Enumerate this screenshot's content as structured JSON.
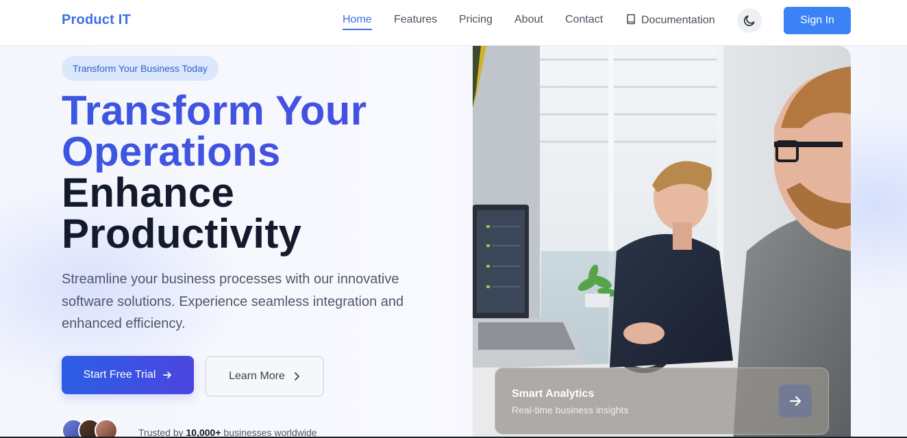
{
  "nav": {
    "brand": "Product IT",
    "links": [
      {
        "label": "Home",
        "active": true
      },
      {
        "label": "Features",
        "active": false
      },
      {
        "label": "Pricing",
        "active": false
      },
      {
        "label": "About",
        "active": false
      },
      {
        "label": "Contact",
        "active": false
      },
      {
        "label": "Documentation",
        "active": false,
        "icon": "book-icon"
      }
    ],
    "theme_toggle_icon": "moon-icon",
    "signin_label": "Sign In"
  },
  "hero": {
    "badge": "Transform Your Business Today",
    "headline_line1": "Transform Your",
    "headline_line2": "Operations",
    "headline_line3": "Enhance",
    "headline_line4": "Productivity",
    "subtitle": "Streamline your business processes with our innovative software solutions. Experience seamless integration and enhanced efficiency.",
    "primary_cta": "Start Free Trial",
    "secondary_cta": "Learn More",
    "trusted_prefix": "Trusted by",
    "trusted_count": "10,000+",
    "trusted_suffix": "businesses worldwide"
  },
  "card": {
    "title": "Smart Analytics",
    "subtitle": "Real-time business insights",
    "button_icon": "arrow-right-icon"
  },
  "colors": {
    "brand": "#3a6fe3",
    "primary_button": "#3b82f6",
    "cta_gradient_start": "#2c5fe5",
    "cta_gradient_end": "#4b45df",
    "headline_dark": "#141a2b"
  }
}
